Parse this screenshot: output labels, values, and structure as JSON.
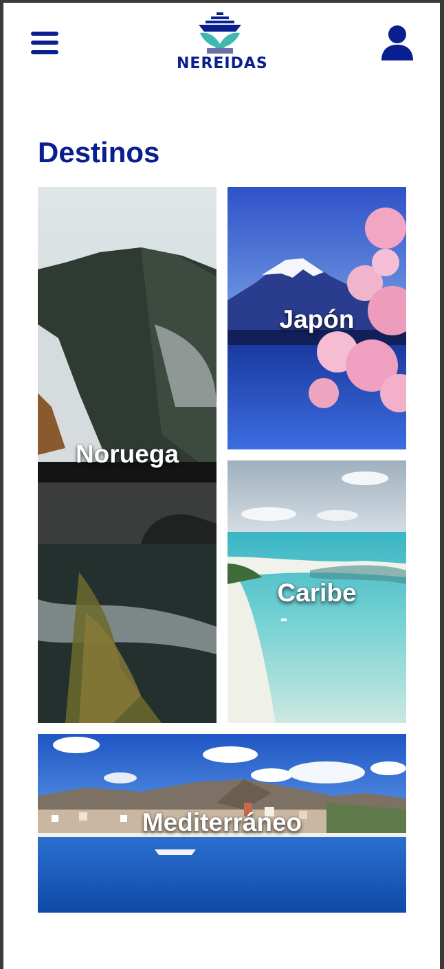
{
  "header": {
    "menu_icon": "hamburger-menu-icon",
    "logo_text": "NEREIDAS",
    "user_icon": "user-icon"
  },
  "section": {
    "title": "Destinos"
  },
  "destinations": [
    {
      "name": "Noruega"
    },
    {
      "name": "Japón"
    },
    {
      "name": "Caribe"
    },
    {
      "name": "Mediterráneo"
    }
  ],
  "colors": {
    "brand_blue": "#0a1f8f",
    "logo_teal": "#3fb8b0",
    "background": "#ffffff"
  }
}
